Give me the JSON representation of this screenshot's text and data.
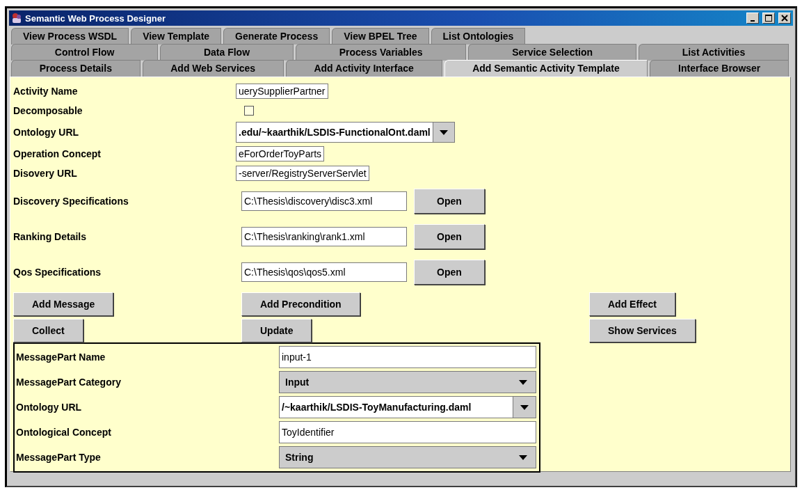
{
  "window": {
    "title": "Semantic Web Process Designer"
  },
  "tab_rows": [
    {
      "tabs": [
        {
          "label": "View Process WSDL",
          "selected": false
        },
        {
          "label": "View Template",
          "selected": false
        },
        {
          "label": "Generate Process",
          "selected": false
        },
        {
          "label": "View BPEL Tree",
          "selected": false
        },
        {
          "label": "List Ontologies",
          "selected": false
        }
      ]
    },
    {
      "tabs": [
        {
          "label": "Control Flow",
          "selected": false
        },
        {
          "label": "Data Flow",
          "selected": false
        },
        {
          "label": "Process Variables",
          "selected": false
        },
        {
          "label": "Service Selection",
          "selected": false
        },
        {
          "label": "List Activities",
          "selected": false
        }
      ]
    },
    {
      "tabs": [
        {
          "label": "Process Details",
          "selected": false
        },
        {
          "label": "Add Web Services",
          "selected": false
        },
        {
          "label": "Add Activity Interface",
          "selected": false
        },
        {
          "label": "Add Semantic Activity Template",
          "selected": true
        },
        {
          "label": "Interface Browser",
          "selected": false
        }
      ]
    }
  ],
  "form": {
    "fields": [
      {
        "kind": "text",
        "label": "Activity Name",
        "value": "uerySupplierPartner"
      },
      {
        "kind": "checkbox",
        "label": "Decomposable",
        "checked": false
      },
      {
        "kind": "combo",
        "label": "Ontology URL",
        "value": ".edu/~kaarthik/LSDIS-FunctionalOnt.daml"
      },
      {
        "kind": "text",
        "label": "Operation Concept",
        "value": "eForOrderToyParts"
      },
      {
        "kind": "text",
        "label": "Disovery URL",
        "value": "-server/RegistryServerServlet"
      },
      {
        "kind": "file",
        "label": "Discovery Specifications",
        "value": "C:\\Thesis\\discovery\\disc3.xml",
        "button": "Open"
      },
      {
        "kind": "file",
        "label": "Ranking Details",
        "value": "C:\\Thesis\\ranking\\rank1.xml",
        "button": "Open"
      },
      {
        "kind": "file",
        "label": "Qos Specifications",
        "value": "C:\\Thesis\\qos\\qos5.xml",
        "button": "Open"
      }
    ]
  },
  "button_rows": [
    [
      "Add Message",
      "Add Precondition",
      "Add Effect"
    ],
    [
      "Collect",
      "Update",
      "Show Services"
    ]
  ],
  "message_part": {
    "fields": [
      {
        "kind": "text",
        "label": "MessagePart Name",
        "value": "input-1"
      },
      {
        "kind": "choice",
        "label": "MessagePart Category",
        "value": "Input"
      },
      {
        "kind": "combo",
        "label": "Ontology URL",
        "value": "/~kaarthik/LSDIS-ToyManufacturing.daml"
      },
      {
        "kind": "text",
        "label": "Ontological Concept",
        "value": "ToyIdentifier"
      },
      {
        "kind": "choice",
        "label": "MessagePart Type",
        "value": "String"
      }
    ]
  }
}
